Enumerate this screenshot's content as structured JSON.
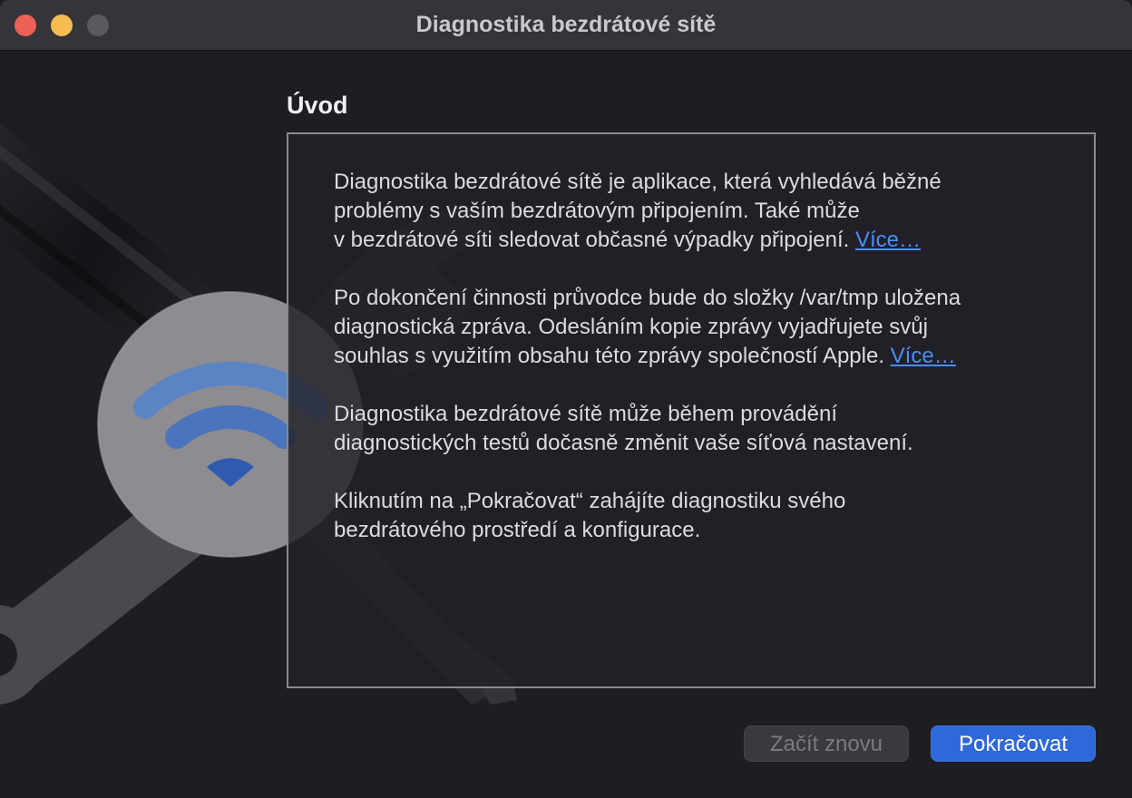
{
  "window": {
    "title": "Diagnostika bezdrátové sítě"
  },
  "section_title": "Úvod",
  "paragraphs": [
    {
      "lines": [
        "Diagnostika bezdrátové sítě je aplikace, která vyhledává běžné",
        "problémy s vaším bezdrátovým připojením. Také může",
        "v bezdrátové síti sledovat občasné výpadky připojení."
      ],
      "link": "Více…"
    },
    {
      "lines": [
        "Po dokončení činnosti průvodce bude do složky /var/tmp uložena",
        "diagnostická zpráva. Odesláním kopie zprávy vyjadřujete svůj",
        "souhlas s využitím obsahu této zprávy společností Apple."
      ],
      "link": "Více…"
    },
    {
      "lines": [
        "Diagnostika bezdrátové sítě může během provádění",
        "diagnostických testů dočasně změnit vaše síťová nastavení."
      ]
    },
    {
      "lines": [
        "Kliknutím na „Pokračovat“ zahájíte diagnostiku svého",
        "bezdrátového prostředí a konfigurace."
      ]
    }
  ],
  "buttons": {
    "restart": "Začít znovu",
    "continue": "Pokračovat"
  },
  "icons": [
    "close-icon",
    "minimize-icon",
    "zoom-icon",
    "wifi-icon",
    "wrench-icon",
    "screwdriver-icon"
  ],
  "colors": {
    "accent": "#2e68d9",
    "link": "#4b8ef7",
    "close": "#ed5f57",
    "minimize": "#f5bd4f"
  }
}
